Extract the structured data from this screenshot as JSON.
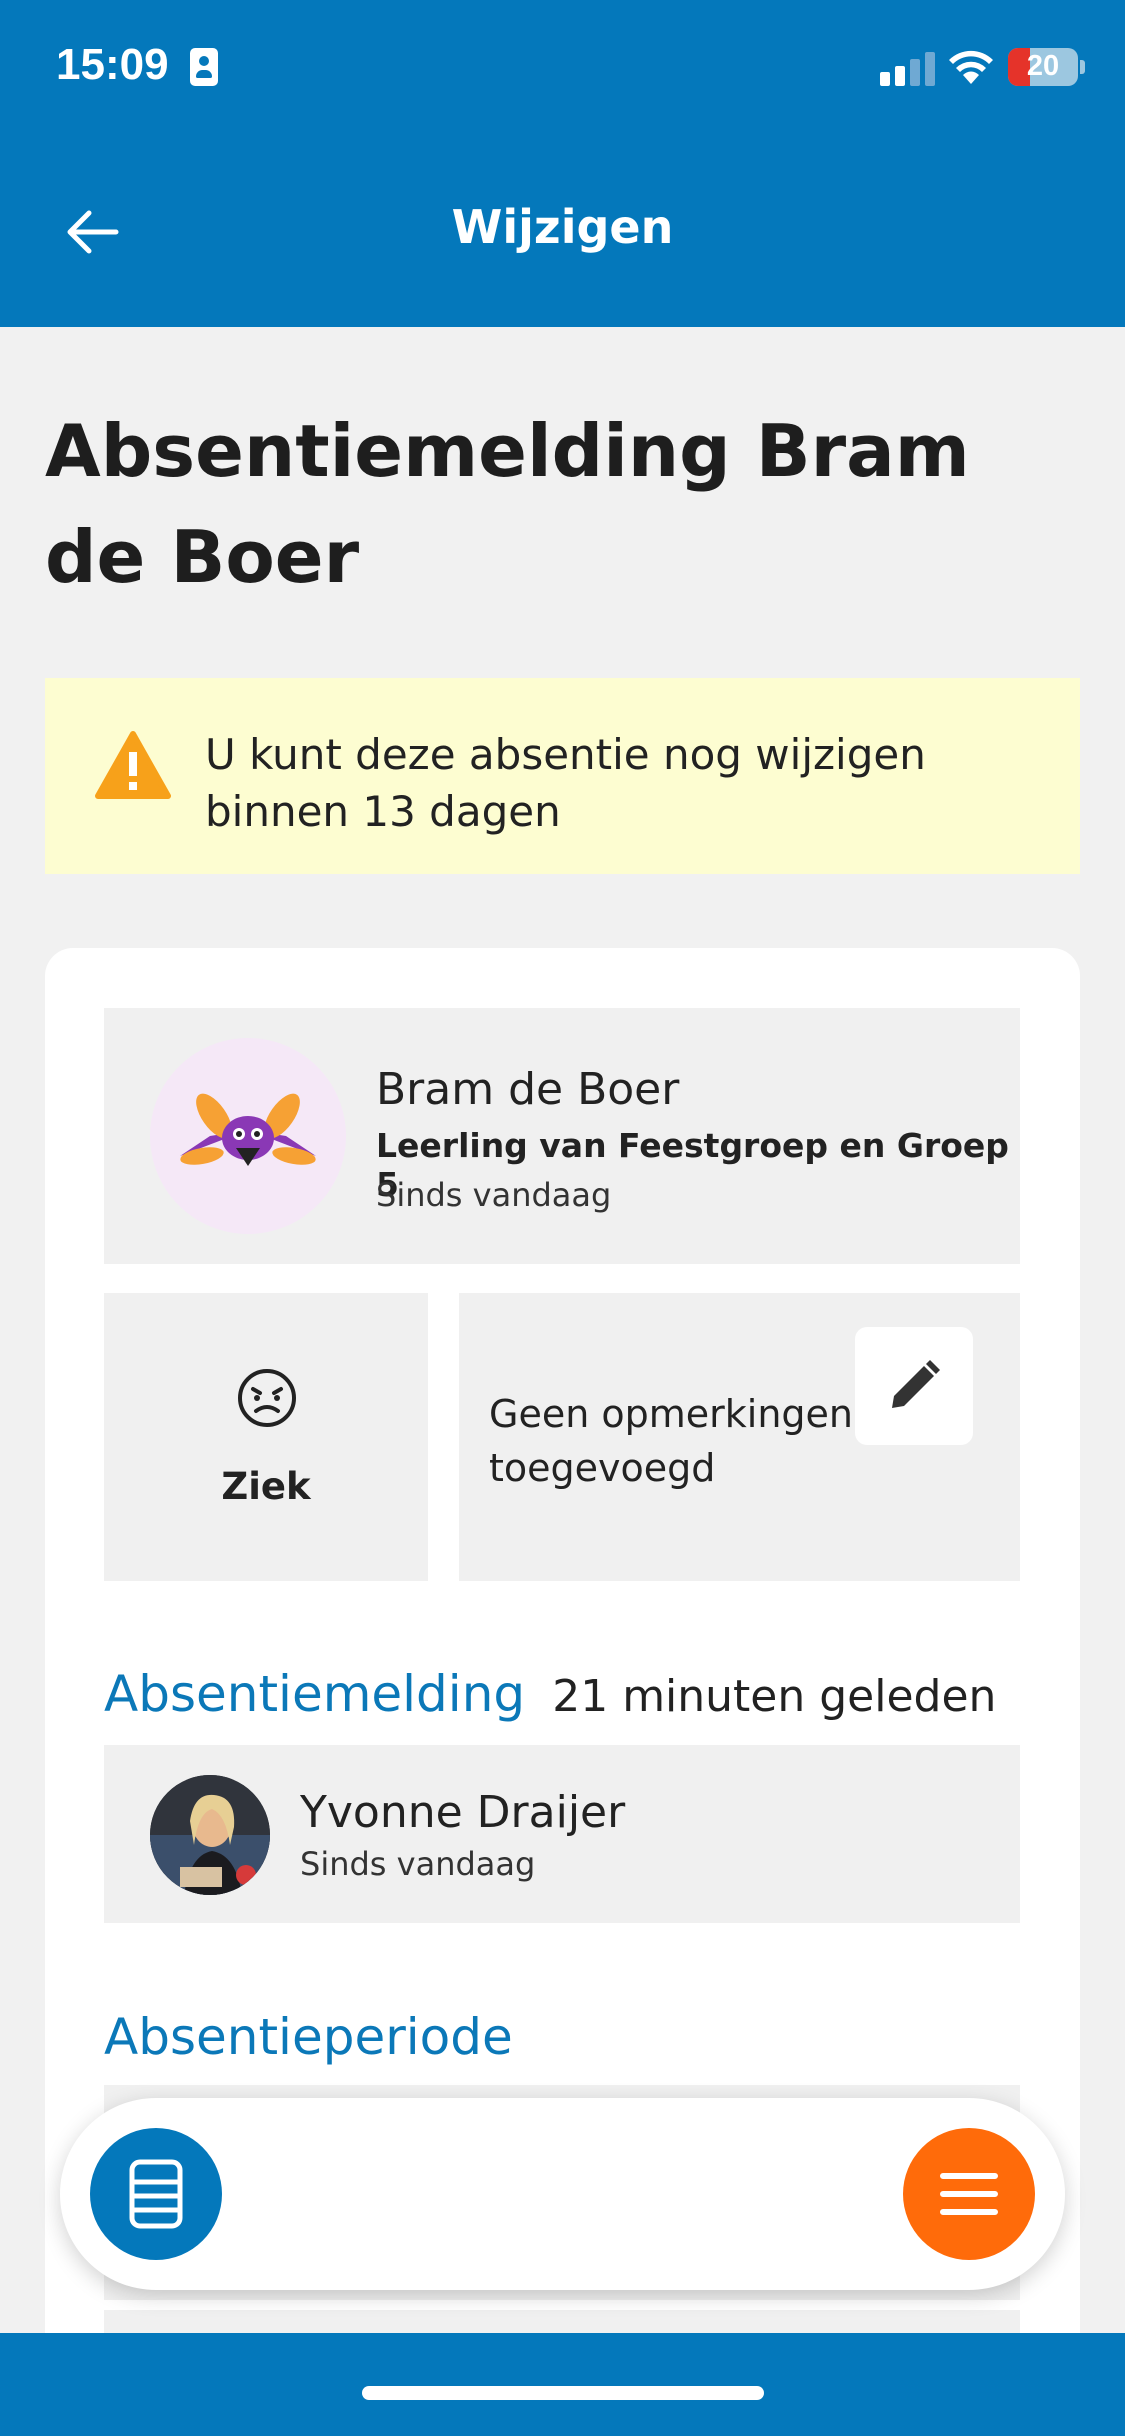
{
  "status_bar": {
    "time": "15:09",
    "battery": "20",
    "icons": [
      "id-card-icon",
      "signal-icon",
      "wifi-icon",
      "battery-icon"
    ]
  },
  "nav": {
    "title": "Wijzigen",
    "back_icon": "arrow-left-icon"
  },
  "page": {
    "title": "Absentiemelding Bram de Boer"
  },
  "warning": {
    "icon": "warning-triangle-icon",
    "text": "U kunt deze absentie nog wijzigen binnen 13 dagen"
  },
  "student": {
    "name": "Bram de Boer",
    "group": "Leerling van Feestgroep en Groep 5",
    "since": "Sinds vandaag"
  },
  "reason": {
    "icon": "sick-face-icon",
    "label": "Ziek"
  },
  "remarks": {
    "text": "Geen opmerkingen toegevoegd",
    "edit_icon": "pencil-icon"
  },
  "report": {
    "title": "Absentiemelding",
    "time": "21 minuten geleden",
    "reporter_name": "Yvonne Draijer",
    "reporter_since": "Sinds vandaag"
  },
  "period": {
    "title": "Absentieperiode"
  },
  "bottom_bar": {
    "left_icon": "book-icon",
    "right_icon": "menu-icon"
  },
  "colors": {
    "primary": "#0478bb",
    "accent": "#ff6b0a",
    "warning_bg": "#fdfdd1",
    "warning_icon": "#f7a11a",
    "section_title": "#0b78b8"
  }
}
